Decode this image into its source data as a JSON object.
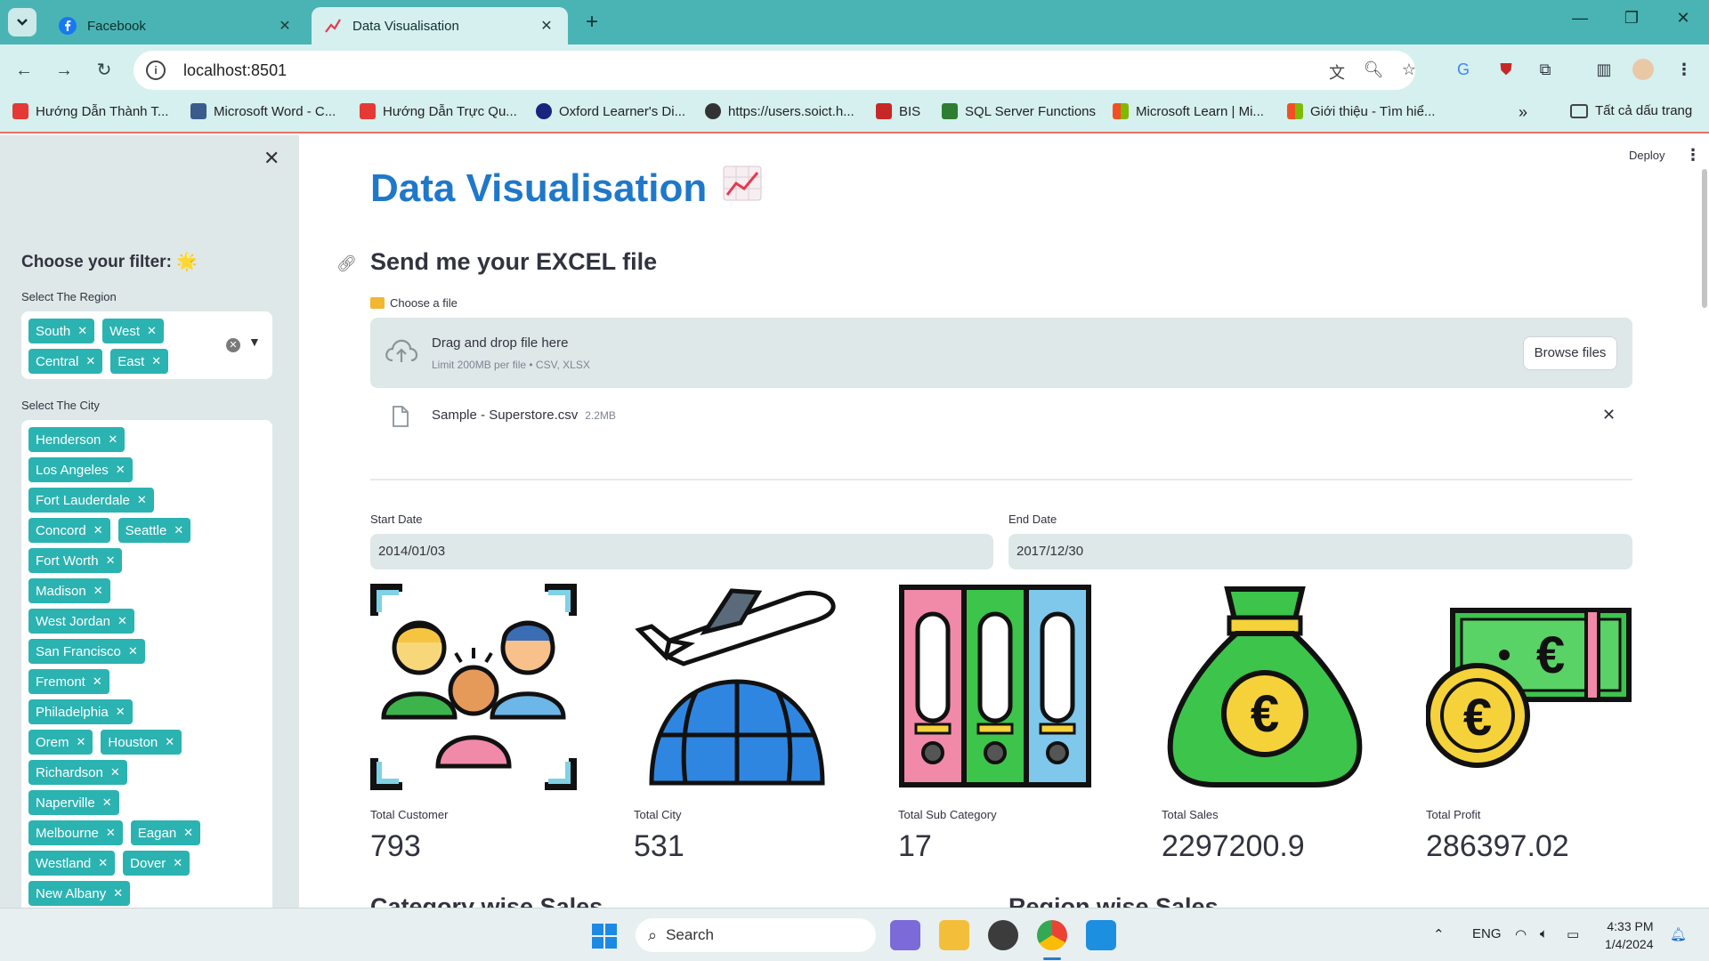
{
  "browser": {
    "tabs": [
      {
        "title": "Facebook",
        "active": false
      },
      {
        "title": "Data Visualisation",
        "active": true
      }
    ],
    "address": "localhost:8501",
    "bookmarks": [
      {
        "label": "Hướng Dẫn Thành T...",
        "color": "#e53935"
      },
      {
        "label": "Microsoft Word - C...",
        "color": "#3a5b8c"
      },
      {
        "label": "Hướng Dẫn Trực Qu...",
        "color": "#e53935"
      },
      {
        "label": "Oxford Learner's Di...",
        "color": "#1a237e"
      },
      {
        "label": "https://users.soict.h...",
        "color": "#333333"
      },
      {
        "label": "BIS",
        "color": "#c62828"
      },
      {
        "label": "SQL Server Functions",
        "color": "#2e7d32"
      },
      {
        "label": "Microsoft Learn | Mi...",
        "color": "#f25022"
      },
      {
        "label": "Giới thiệu - Tìm hiể...",
        "color": "#f25022"
      }
    ],
    "all_bookmarks": "Tất cả dấu trang"
  },
  "sidebar": {
    "title": "Choose your filter:",
    "title_emoji": "🌟",
    "region_label": "Select The Region",
    "regions": [
      "South",
      "West",
      "Central",
      "East"
    ],
    "city_label": "Select The City",
    "cities": [
      "Henderson",
      "Los Angeles",
      "Fort Lauderdale",
      "Concord",
      "Seattle",
      "Fort Worth",
      "Madison",
      "West Jordan",
      "San Francisco",
      "Fremont",
      "Philadelphia",
      "Orem",
      "Houston",
      "Richardson",
      "Naperville",
      "Melbourne",
      "Eagan",
      "Westland",
      "Dover",
      "New Albany"
    ]
  },
  "header": {
    "deploy": "Deploy"
  },
  "main": {
    "title": "Data Visualisation",
    "title_emoji": "📈",
    "upload_heading": "Send me your EXCEL file",
    "choose_label": "Choose a file",
    "dropzone_title": "Drag and drop file here",
    "dropzone_limit": "Limit 200MB per file • CSV, XLSX",
    "browse_label": "Browse files",
    "file_name": "Sample - Superstore.csv",
    "file_size": "2.2MB",
    "start_date_label": "Start Date",
    "start_date": "2014/01/03",
    "end_date_label": "End Date",
    "end_date": "2017/12/30",
    "metrics": [
      {
        "label": "Total Customer",
        "value": "793",
        "icon": "customers-icon"
      },
      {
        "label": "Total City",
        "value": "531",
        "icon": "globe-plane-icon"
      },
      {
        "label": "Total Sub Category",
        "value": "17",
        "icon": "binders-icon"
      },
      {
        "label": "Total Sales",
        "value": "2297200.9",
        "icon": "money-bag-icon"
      },
      {
        "label": "Total Profit",
        "value": "286397.02",
        "icon": "cash-coin-icon"
      }
    ],
    "section_left": "Category wise Sales",
    "section_right": "Region wise Sales"
  },
  "taskbar": {
    "search_placeholder": "Search",
    "language": "ENG",
    "time": "4:33 PM",
    "date": "1/4/2024"
  },
  "colors": {
    "accent": "#2bb3b1",
    "title_blue": "#1f78c9",
    "chrome": "#4ab4b4"
  }
}
